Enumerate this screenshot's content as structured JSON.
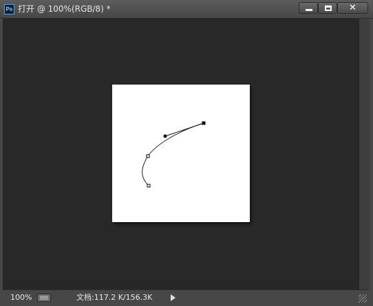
{
  "window": {
    "app_icon": "photoshop-ps-logo",
    "app_icon_text": "Ps",
    "title": "打开 @ 100%(RGB/8) *",
    "buttons": {
      "minimize_icon": "minimize-icon",
      "maximize_icon": "maximize-icon",
      "close_icon": "close-icon",
      "close_glyph": "✕"
    }
  },
  "canvas": {
    "background_color": "#282828",
    "document_color": "#ffffff"
  },
  "status_bar": {
    "zoom": "100%",
    "preview_icon": "status-preview-icon",
    "doc_info": "文档:117.2 K/156.3K",
    "menu_arrow_icon": "triangle-right-icon",
    "resize_icon": "resize-grip-icon"
  },
  "colors": {
    "title_bar": "#4f4f4f",
    "workspace": "#282828",
    "status_bar": "#474747",
    "text": "#e6e6e6"
  }
}
